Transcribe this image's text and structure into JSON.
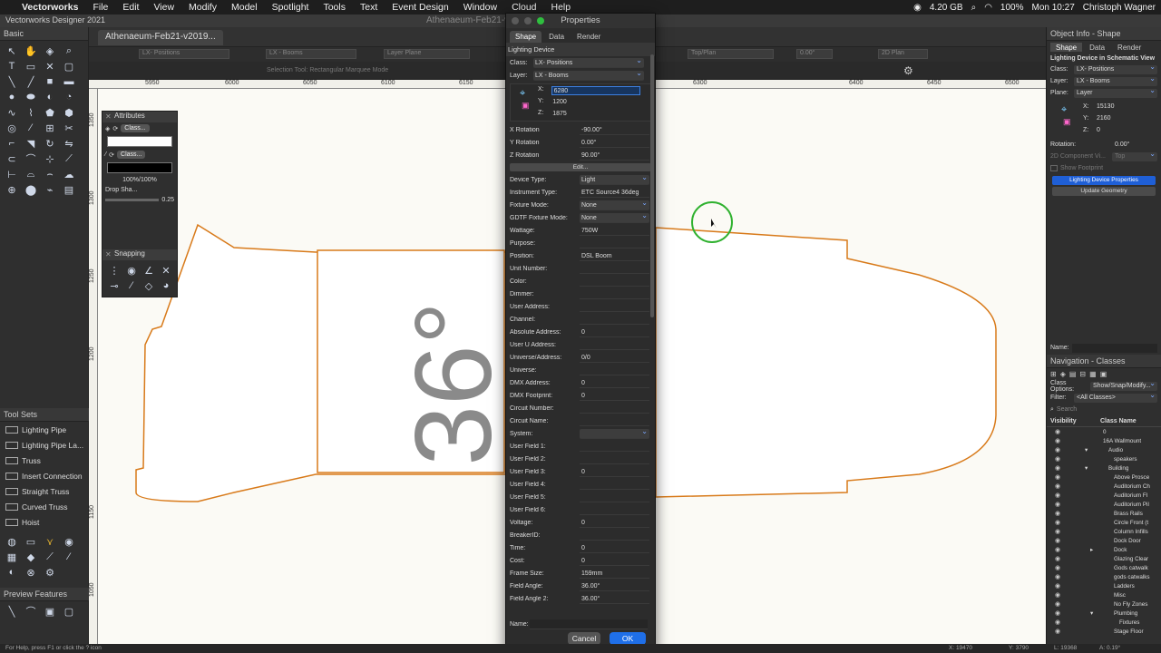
{
  "menubar": {
    "app": "Vectorworks",
    "items": [
      "File",
      "Edit",
      "View",
      "Modify",
      "Model",
      "Spotlight",
      "Tools",
      "Text",
      "Event Design",
      "Window",
      "Cloud",
      "Help"
    ],
    "memory": "4.20 GB",
    "battery": "100%",
    "clock": "Mon 10:27",
    "user": "Christoph Wagner"
  },
  "window": {
    "title": "Athenaeum-Feb21-v2019.vwx - WATERMARKED FILE",
    "app_name": "Vectorworks Designer 2021"
  },
  "doc": {
    "tab": "Athenaeum-Feb21-v2019...",
    "viewbar": {
      "class": "LX- Positions",
      "layer": "LX - Booms",
      "layer_plane": "Layer Plane",
      "view": "Top/Plan",
      "rotation": "0.00°",
      "render": "2D Plan"
    },
    "mode_hint": "Selection Tool: Rectangular Marquee Mode"
  },
  "rulers": {
    "h": [
      "5950",
      "6000",
      "6050",
      "6100",
      "6150",
      "6300",
      "6400",
      "6450",
      "6500"
    ],
    "v": [
      "1350",
      "1300",
      "1250",
      "1200",
      "1150",
      "1100",
      "1050"
    ]
  },
  "left": {
    "basic_title": "Basic",
    "toolsets_title": "Tool Sets",
    "toolsets": [
      "Lighting Pipe",
      "Lighting Pipe La...",
      "Truss",
      "Insert Connection",
      "Straight Truss",
      "Curved Truss",
      "Hoist"
    ],
    "preview_title": "Preview Features"
  },
  "attributes": {
    "title": "Attributes",
    "fill_class": "Class...",
    "pen_class": "Class...",
    "opacity": "100%/100%",
    "drop_shadow": "Drop Sha...",
    "line_weight": "0.25",
    "snapping_title": "Snapping"
  },
  "canvas": {
    "label": "36°"
  },
  "properties": {
    "title": "Properties",
    "tabs": [
      "Shape",
      "Data",
      "Render"
    ],
    "object_type": "Lighting Device",
    "class_label": "Class:",
    "class_value": "LX- Positions",
    "layer_label": "Layer:",
    "layer_value": "LX - Booms",
    "x_label": "X:",
    "x_value": "6280",
    "y_label": "Y:",
    "y_value": "1200",
    "z_label": "Z:",
    "z_value": "1875",
    "rotations": [
      {
        "label": "X Rotation",
        "value": "-90.00°"
      },
      {
        "label": "Y Rotation",
        "value": "0.00°"
      },
      {
        "label": "Z Rotation",
        "value": "90.00°"
      }
    ],
    "edit_button": "Edit...",
    "fields": [
      {
        "label": "Device Type:",
        "value": "Light",
        "popup": true
      },
      {
        "label": "Instrument Type:",
        "value": "ETC Source4 36deg",
        "popup": false
      },
      {
        "label": "Fixture Mode:",
        "value": "None",
        "popup": true
      },
      {
        "label": "GDTF Fixture Mode:",
        "value": "None",
        "popup": true
      },
      {
        "label": "Wattage:",
        "value": "750W",
        "popup": false
      },
      {
        "label": "Purpose:",
        "value": "",
        "popup": false
      },
      {
        "label": "Position:",
        "value": "DSL Boom",
        "popup": false
      },
      {
        "label": "Unit Number:",
        "value": "",
        "popup": false
      },
      {
        "label": "Color:",
        "value": "",
        "popup": false
      },
      {
        "label": "Dimmer:",
        "value": "",
        "popup": false
      },
      {
        "label": "User Address:",
        "value": "",
        "popup": false
      },
      {
        "label": "Channel:",
        "value": "",
        "popup": false
      },
      {
        "label": "Absolute Address:",
        "value": "0",
        "popup": false
      },
      {
        "label": "User U Address:",
        "value": "",
        "popup": false
      },
      {
        "label": "Universe/Address:",
        "value": "0/0",
        "popup": false
      },
      {
        "label": "Universe:",
        "value": "",
        "popup": false
      },
      {
        "label": "DMX Address:",
        "value": "0",
        "popup": false
      },
      {
        "label": "DMX Footprint:",
        "value": "0",
        "popup": false
      },
      {
        "label": "Circuit Number:",
        "value": "",
        "popup": false
      },
      {
        "label": "Circuit Name:",
        "value": "",
        "popup": false
      },
      {
        "label": "System:",
        "value": "",
        "popup": true
      },
      {
        "label": "User Field 1:",
        "value": "",
        "popup": false
      },
      {
        "label": "User Field 2:",
        "value": "",
        "popup": false
      },
      {
        "label": "User Field 3:",
        "value": "0",
        "popup": false
      },
      {
        "label": "User Field 4:",
        "value": "",
        "popup": false
      },
      {
        "label": "User Field 5:",
        "value": "",
        "popup": false
      },
      {
        "label": "User Field 6:",
        "value": "",
        "popup": false
      },
      {
        "label": "Voltage:",
        "value": "0",
        "popup": false
      },
      {
        "label": "BreakerID:",
        "value": "",
        "popup": false
      },
      {
        "label": "Time:",
        "value": "0",
        "popup": false
      },
      {
        "label": "Cost:",
        "value": "0",
        "popup": false
      },
      {
        "label": "Frame Size:",
        "value": "159mm",
        "popup": false
      },
      {
        "label": "Field Angle:",
        "value": "36.00°",
        "popup": false
      },
      {
        "label": "Field Angle 2:",
        "value": "36.00°",
        "popup": false
      }
    ],
    "name_label": "Name:",
    "cancel": "Cancel",
    "ok": "OK"
  },
  "objinfo": {
    "title": "Object Info - Shape",
    "tabs": [
      "Shape",
      "Data",
      "Render"
    ],
    "object_type": "Lighting Device in Schematic View",
    "class_label": "Class:",
    "class_value": "LX- Positions",
    "layer_label": "Layer:",
    "layer_value": "LX - Booms",
    "plane_label": "Plane:",
    "plane_value": "Layer",
    "x_label": "X:",
    "x_value": "15130",
    "y_label": "Y:",
    "y_value": "2160",
    "z_label": "Z:",
    "z_value": "0",
    "rotation_label": "Rotation:",
    "rotation_value": "0.00°",
    "component_label": "2D Component Vi...",
    "component_value": "Top",
    "show_footprint": "Show Footprint",
    "props_button": "Lighting Device Properties",
    "update_button": "Update Geometry",
    "name_label": "Name:"
  },
  "navigation": {
    "title": "Navigation - Classes",
    "options_label": "Class Options:",
    "options_value": "Show/Snap/Modify...",
    "filter_label": "Filter:",
    "filter_value": "<All Classes>",
    "search_placeholder": "Search",
    "col_visibility": "Visibility",
    "col_name": "Class Name",
    "classes": [
      "0",
      "16A Wallmount",
      "Audio",
      "speakers",
      "Building",
      "Above Prosce",
      "Auditorium Ch",
      "Auditorium Fl",
      "Auditorium Pil",
      "Brass Rails",
      "Circle Front (t",
      "Column Infills",
      "Dock Door",
      "Dock",
      "Glazing Clear",
      "Gods catwalk",
      "gods catwalks",
      "Ladders",
      "Misc",
      "No Fly Zones",
      "Plumbing",
      "Fixtures",
      "Stage Floor"
    ]
  },
  "status": {
    "help": "For Help, press F1 or click the ? icon",
    "x": "X: 19470",
    "y": "Y: 3790",
    "l": "L: 19368",
    "a": "A: 0.19°"
  },
  "colors": {
    "outline": "#d87a1a",
    "accent": "#1f5fd6",
    "ok_button": "#1f6fe8",
    "cursor_ring": "#2fb12f"
  }
}
